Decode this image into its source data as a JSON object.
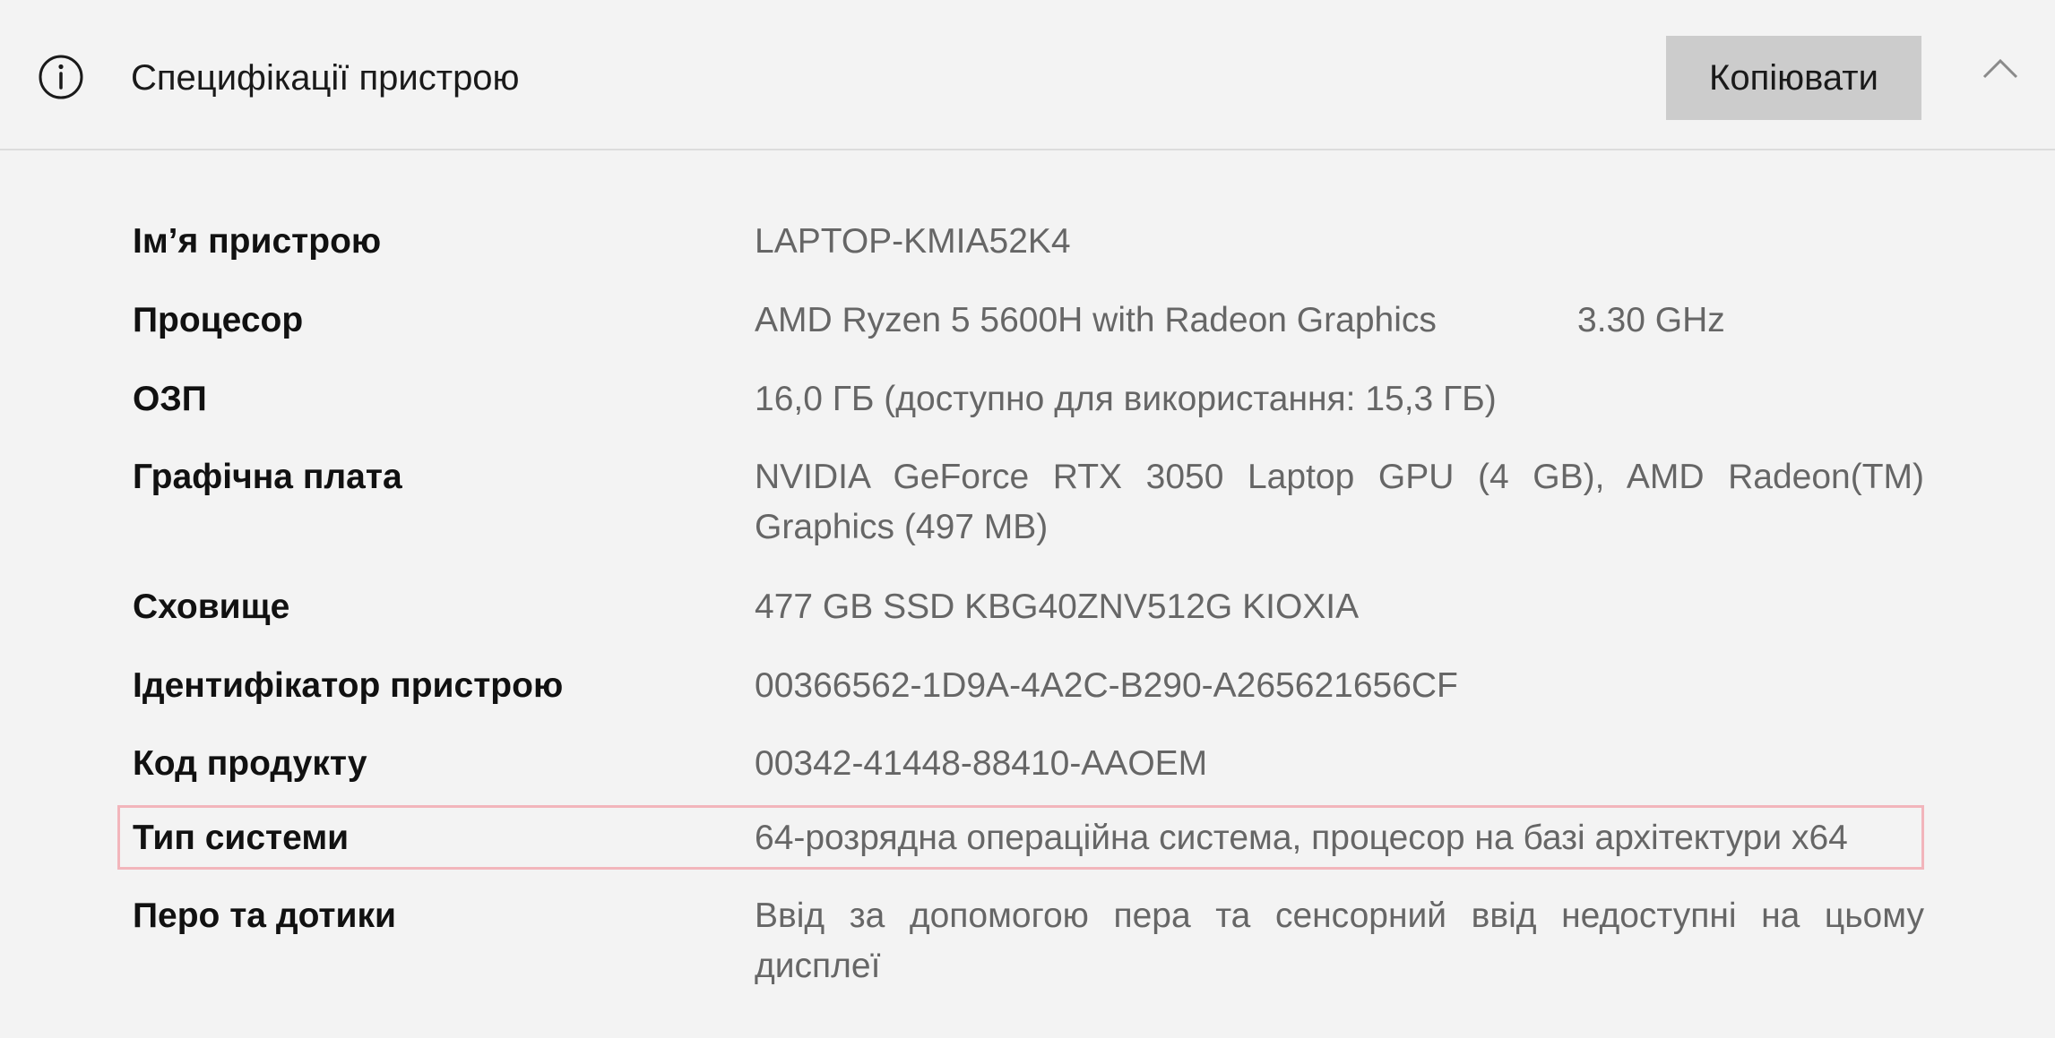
{
  "header": {
    "title": "Специфікації пристрою",
    "copy_label": "Копіювати",
    "info_icon": "info-icon",
    "collapse_icon": "chevron-up-icon"
  },
  "specs": [
    {
      "label": "Ім’я пристрою",
      "value": "LAPTOP-KMIA52K4"
    },
    {
      "label": "Процесор",
      "value": "AMD Ryzen 5 5600H with Radeon Graphics",
      "extra": "3.30 GHz"
    },
    {
      "label": "ОЗП",
      "value": "16,0 ГБ (доступно для використання: 15,3 ГБ)"
    },
    {
      "label": "Графічна плата",
      "value": "NVIDIA GeForce RTX 3050 Laptop GPU (4 GB), AMD Radeon(TM) Graphics (497 MB)"
    },
    {
      "label": "Сховище",
      "value": "477 GB SSD KBG40ZNV512G KIOXIA"
    },
    {
      "label": "Ідентифікатор пристрою",
      "value": "00366562-1D9A-4A2C-B290-A265621656CF"
    },
    {
      "label": "Код продукту",
      "value": "00342-41448-88410-AAOEM"
    },
    {
      "label": "Тип системи",
      "value": "64-розрядна операційна система, процесор на базі архітектури x64"
    },
    {
      "label": "Перо та дотики",
      "value": "Ввід за допомогою пера та сенсорний ввід недоступні на цьому дисплеї"
    }
  ],
  "colors": {
    "background": "#f3f3f3",
    "button": "#cccccc",
    "highlight_border": "#f2b5bb",
    "label_text": "#111111",
    "value_text": "#666666"
  }
}
